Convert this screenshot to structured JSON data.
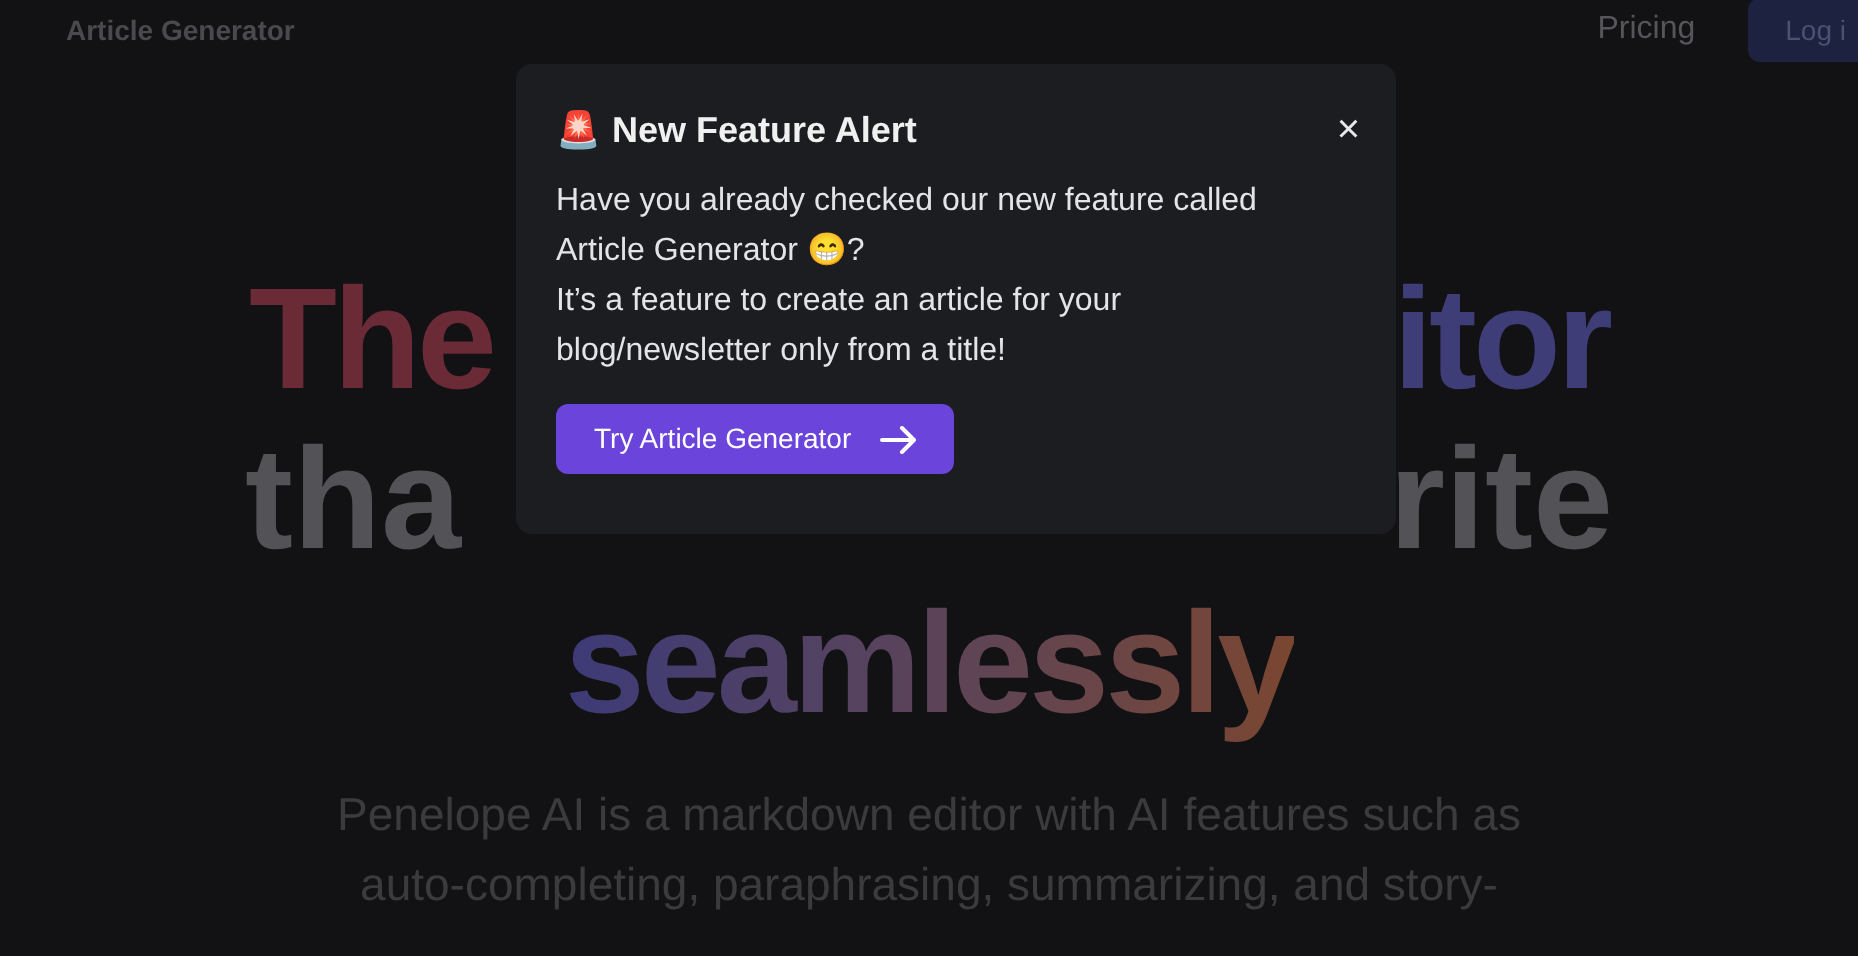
{
  "nav": {
    "brand": "Article Generator",
    "links": [
      "Pricing"
    ],
    "login_button": "Log i"
  },
  "hero": {
    "line_1": {
      "left": "The",
      "right": "itor"
    },
    "line_2": {
      "left": "tha",
      "right": "rite"
    },
    "line_3": "seamlessly",
    "description": [
      "Penelope AI is a markdown editor with AI features such as",
      "auto-completing, paraphrasing, summarizing, and story-"
    ]
  },
  "modal": {
    "icon": "🚨",
    "title": "New Feature Alert",
    "close": "×",
    "body": [
      "Have you already checked our new feature called Article Generator 😁?",
      "It’s a feature to create an article for your blog/newsletter only from a title!"
    ],
    "button": "Try Article Generator"
  }
}
